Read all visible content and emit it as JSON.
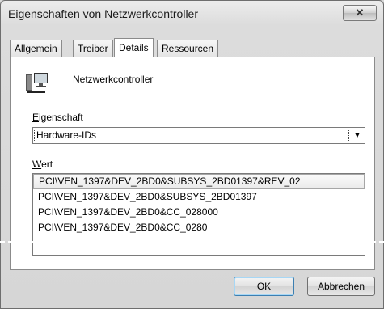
{
  "window": {
    "title": "Eigenschaften von Netzwerkcontroller",
    "close_glyph": "✕"
  },
  "tabs": [
    {
      "label": "Allgemein",
      "active": false
    },
    {
      "label": "Treiber",
      "active": false
    },
    {
      "label": "Details",
      "active": true
    },
    {
      "label": "Ressourcen",
      "active": false
    }
  ],
  "device": {
    "icon": "network-adapter-icon",
    "name": "Netzwerkcontroller"
  },
  "property": {
    "label_first": "E",
    "label_rest": "igenschaft",
    "selected_value": "Hardware-IDs"
  },
  "value": {
    "label_first": "W",
    "label_rest": "ert",
    "items": [
      "PCI\\VEN_1397&DEV_2BD0&SUBSYS_2BD01397&REV_02",
      "PCI\\VEN_1397&DEV_2BD0&SUBSYS_2BD01397",
      "PCI\\VEN_1397&DEV_2BD0&CC_028000",
      "PCI\\VEN_1397&DEV_2BD0&CC_0280"
    ]
  },
  "buttons": {
    "ok": "OK",
    "cancel": "Abbrechen"
  }
}
